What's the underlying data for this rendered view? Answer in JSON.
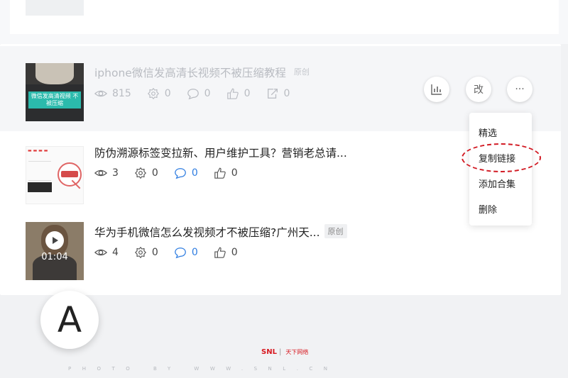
{
  "posts": [
    {
      "title": "iphone微信发高清长视频不被压缩教程",
      "badge": "原创",
      "views": "815",
      "settings": "0",
      "comments": "0",
      "likes": "0",
      "shares": "0",
      "thumb_caption": "微信发高清视频 不被压缩"
    },
    {
      "title": "防伪溯源标签变拉新、用户维护工具？营销老总请...",
      "views": "3",
      "settings": "0",
      "comments": "0",
      "likes": "0"
    },
    {
      "title": "华为手机微信怎么发视频才不被压缩?广州天...",
      "badge": "原创",
      "views": "4",
      "settings": "0",
      "comments": "0",
      "likes": "0",
      "video_duration": "01:04"
    }
  ],
  "actions": {
    "edit_label": "改",
    "more_label": "···"
  },
  "menu": [
    "精选",
    "复制链接",
    "添加合集",
    "删除"
  ],
  "annotation_letter": "A",
  "watermark": {
    "brand": "SNL",
    "brand_cn": "天下网络",
    "credit": "PHOTO BY WWW.SNL.CN"
  }
}
